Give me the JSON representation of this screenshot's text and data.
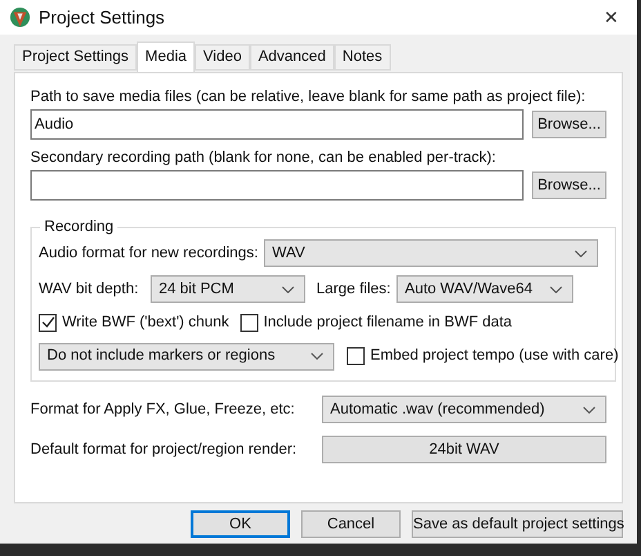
{
  "window": {
    "title": "Project Settings",
    "close": "✕"
  },
  "tabs": [
    {
      "label": "Project Settings",
      "selected": false
    },
    {
      "label": "Media",
      "selected": true
    },
    {
      "label": "Video",
      "selected": false
    },
    {
      "label": "Advanced",
      "selected": false
    },
    {
      "label": "Notes",
      "selected": false
    }
  ],
  "paths": [
    {
      "label": "Path to save media files (can be relative, leave blank for same path as project file):",
      "value": "Audio",
      "button": "Browse..."
    },
    {
      "label": "Secondary recording path (blank for none, can be enabled per-track):",
      "button": "Browse..."
    }
  ],
  "recording": {
    "title": "Recording",
    "audio_format": {
      "label": "Audio format for new recordings:",
      "value": "WAV"
    },
    "bit_depth": {
      "label": "WAV bit depth:",
      "value": "24 bit PCM"
    },
    "large_files": {
      "label": "Large files:",
      "value": "Auto WAV/Wave64"
    },
    "write_bwf": {
      "label": "Write BWF ('bext') chunk",
      "checked": true
    },
    "include_filename": {
      "label": "Include project filename in BWF data",
      "checked": false
    },
    "markers": {
      "value": "Do not include markers or regions"
    },
    "embed_tempo": {
      "label": "Embed project tempo (use with care)",
      "checked": false
    }
  },
  "apply_fx": {
    "label": "Format for Apply FX, Glue, Freeze, etc:",
    "value": "Automatic .wav (recommended)"
  },
  "render": {
    "label": "Default format for project/region render:",
    "button": "24bit WAV"
  },
  "buttons": [
    {
      "label": "OK",
      "default": true
    },
    {
      "label": "Cancel",
      "default": false
    },
    {
      "label": "Save as default project settings",
      "default": false
    }
  ]
}
